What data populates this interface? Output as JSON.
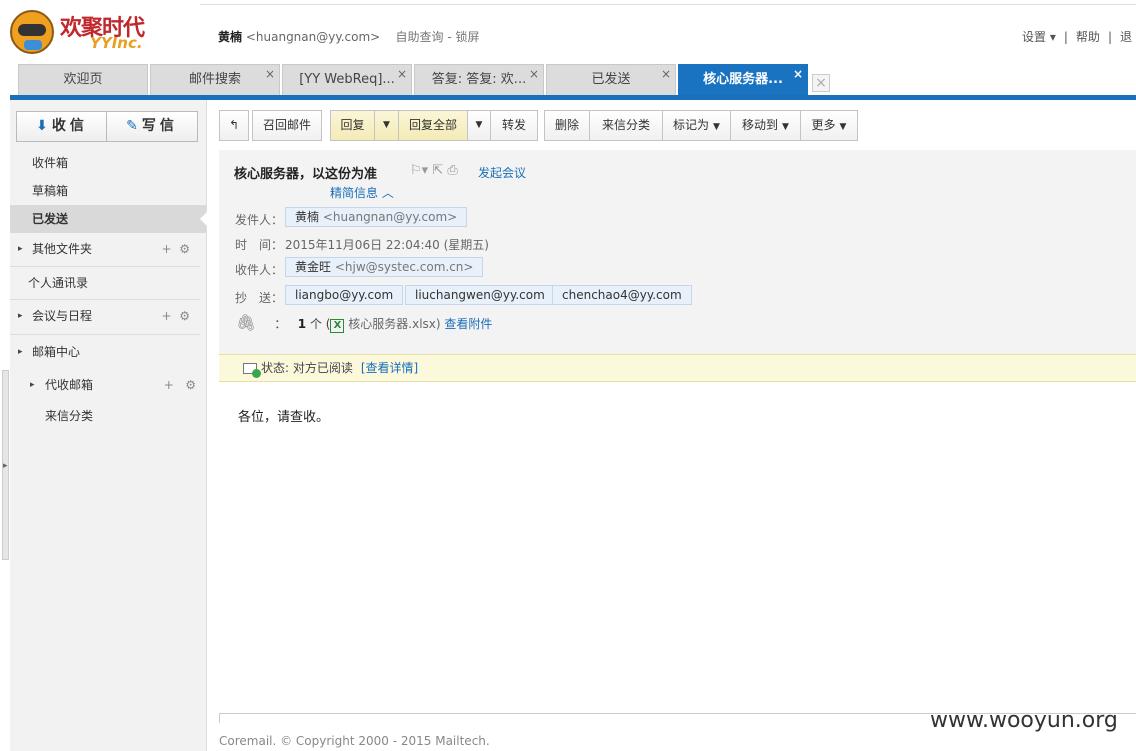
{
  "brand": {
    "logo_cn": "欢聚时代",
    "logo_en": "YYInc."
  },
  "user": {
    "name": "黄楠",
    "email": "<huangnan@yy.com>",
    "self_query": "自助查询",
    "separator": "-",
    "lock": "锁屏"
  },
  "top_links": {
    "settings": "设置 ▾",
    "sep1": "|",
    "help": "帮助",
    "sep2": "|",
    "more": "退"
  },
  "tabs": [
    {
      "label": "欢迎页",
      "close": ""
    },
    {
      "label": "邮件搜索",
      "close": "×"
    },
    {
      "label": "[YY WebReq]...",
      "close": "×"
    },
    {
      "label": "答复: 答复: 欢...",
      "close": "×"
    },
    {
      "label": "已发送",
      "close": "×"
    },
    {
      "label": "核心服务器...",
      "close": "×"
    }
  ],
  "sidebar": {
    "receive": {
      "icon": "⬇",
      "label": "收信"
    },
    "compose": {
      "icon": "✎",
      "label": "写信"
    },
    "inbox": "收件箱",
    "drafts": "草稿箱",
    "sent": "已发送",
    "other_folders": "其他文件夹",
    "contacts": "个人通讯录",
    "calendar": "会议与日程",
    "mailbox_center": "邮箱中心",
    "proxy_mailbox": "代收邮箱",
    "incoming_category": "来信分类",
    "add": "+",
    "gear": "⚙",
    "collapsed_arrow": "▸",
    "edge_arrow": "▸"
  },
  "toolbar": {
    "back": "↰",
    "recall": "召回邮件",
    "reply": "回复",
    "reply_all": "回复全部",
    "forward": "转发",
    "delete": "删除",
    "categorize": "来信分类",
    "mark_as": "标记为",
    "move_to": "移动到",
    "more": "更多",
    "dropdown": "▼"
  },
  "message": {
    "subject": "核心服务器，以这份为准",
    "icons": "⚐▾ ⇱ ⎙",
    "meeting": "发起会议",
    "brief": "精简信息 ︿",
    "from_label": "发件人：",
    "from_name": "黄楠",
    "from_email": "<huangnan@yy.com>",
    "time_label": "时　间：",
    "time": "2015年11月06日 22:04:40 (星期五)",
    "to_label": "收件人：",
    "to_name": "黄金旺",
    "to_email": "<hjw@systec.com.cn>",
    "cc_label": "抄　送：",
    "cc": [
      "liangbo@yy.com",
      "liuchangwen@yy.com",
      "chenchao4@yy.com"
    ],
    "attach_icon": "🖇",
    "attach_colon": "：",
    "attach_count": "1",
    "attach_unit": "个 (",
    "attach_xl": "X",
    "attach_file": "核心服务器.xlsx)",
    "attach_view": "查看附件",
    "status": "状态: 对方已阅读",
    "status_link": "[查看详情]",
    "body": "各位，请查收。"
  },
  "footer": {
    "copyright": "Coremail. © Copyright 2000 - 2015 Mailtech."
  },
  "watermark": "www.wooyun.org",
  "colors": {
    "accent": "#1a6fb8",
    "active_tab": "#1a73c0",
    "status_bg": "#fbf8dc",
    "reply_bg": "#f3ebb6"
  }
}
